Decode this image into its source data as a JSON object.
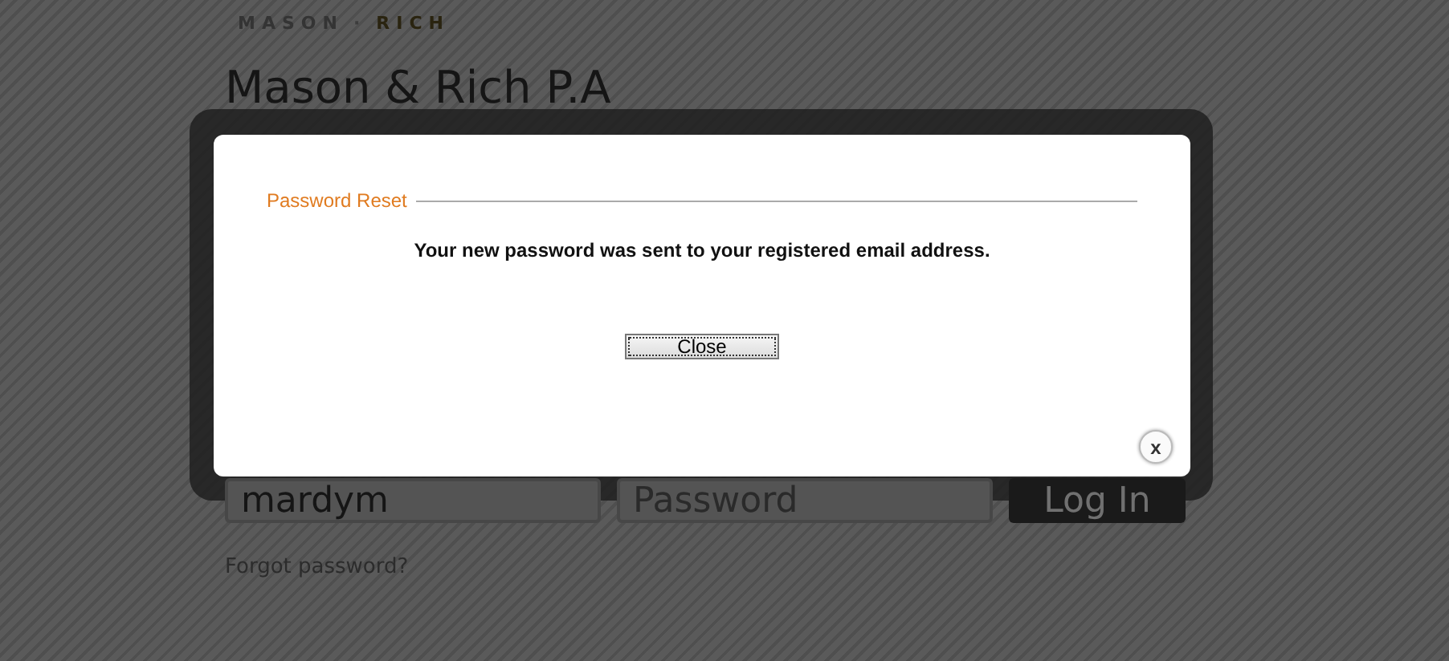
{
  "page": {
    "logo": {
      "first": "MASON",
      "separator": "·",
      "second": "RICH"
    },
    "heading": "Mason & Rich P.A",
    "login": {
      "username": {
        "value": "mardym"
      },
      "password": {
        "placeholder": "Password"
      },
      "button": "Log In",
      "forgot_link": "Forgot password?"
    }
  },
  "dialog": {
    "legend": "Password Reset",
    "message": "Your new password was sent to your registered email address.",
    "button": "Close",
    "close_icon": "x"
  }
}
